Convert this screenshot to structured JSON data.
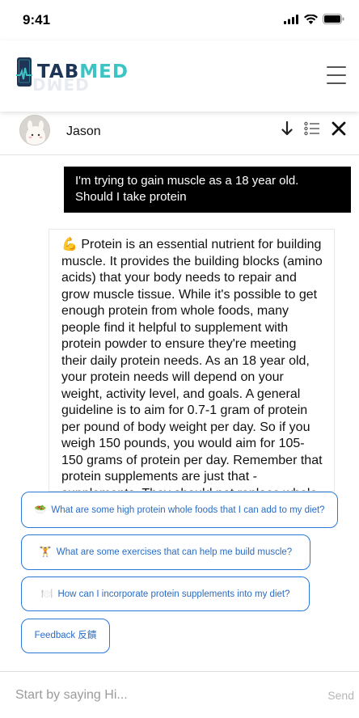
{
  "status_bar": {
    "time": "9:41"
  },
  "app": {
    "logo": {
      "part1": "TAB",
      "part2": "MED",
      "ghost": "DMED"
    },
    "accent_color": "#3cc4c4",
    "brand_color": "#1e3556"
  },
  "chat": {
    "contact_name": "Jason",
    "actions": [
      "arrow-down-icon",
      "list-icon",
      "close-icon"
    ]
  },
  "messages": {
    "user": "I'm trying to gain muscle as a 18 year old. Should I take protein",
    "bot_emoji": "💪",
    "bot": "Protein is an essential nutrient for building muscle. It provides the building blocks (amino acids) that your body needs to repair and grow muscle tissue. While it's possible to get enough protein from whole foods, many people find it helpful to supplement with protein powder to ensure they're meeting their daily protein needs. As an 18 year old, your protein needs will depend on your weight, activity level, and goals. A general guideline is to aim for 0.7-1 gram of protein per pound of body weight per day. So if you weigh 150 pounds, you would aim for 105-150 grams of protein per day. Remember that protein supplements are just that - supplements. They should not replace whole foods."
  },
  "suggestions": [
    {
      "emoji": "🥗",
      "label": "What are some high protein whole foods that I can add to my diet?"
    },
    {
      "emoji": "🏋️",
      "label": "What are some exercises that can help me build muscle?"
    },
    {
      "emoji": "🍽️",
      "label": "How can I incorporate protein supplements into my diet?"
    },
    {
      "emoji": "",
      "label": "Feedback 反饋"
    }
  ],
  "input": {
    "placeholder": "Start by saying Hi...",
    "send_label": "Send"
  }
}
